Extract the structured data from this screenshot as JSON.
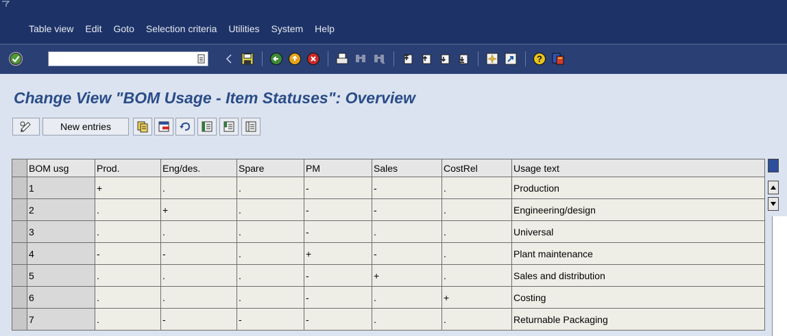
{
  "menu": {
    "items": [
      {
        "label": "Table view"
      },
      {
        "label": "Edit"
      },
      {
        "label": "Goto"
      },
      {
        "label": "Selection criteria"
      },
      {
        "label": "Utilities"
      },
      {
        "label": "System"
      },
      {
        "label": "Help"
      }
    ]
  },
  "toolbar": {
    "command_field_value": "",
    "icons": [
      "enter-icon",
      "back-arrow-icon",
      "save-icon",
      "back-icon",
      "exit-icon",
      "cancel-icon",
      "print-icon",
      "find-icon",
      "find-next-icon",
      "first-page-icon",
      "previous-page-icon",
      "next-page-icon",
      "last-page-icon",
      "create-session-icon",
      "shortcut-icon",
      "help-icon",
      "customize-layout-icon"
    ]
  },
  "title": "Change View \"BOM Usage - Item Statuses\": Overview",
  "app_toolbar": {
    "new_entries_label": "New entries"
  },
  "table": {
    "columns": [
      "BOM usg",
      "Prod.",
      "Eng/des.",
      "Spare",
      "PM",
      "Sales",
      "CostRel",
      "Usage text"
    ],
    "rows": [
      [
        "1",
        "+",
        ".",
        ".",
        "-",
        "-",
        ".",
        "Production"
      ],
      [
        "2",
        ".",
        "+",
        ".",
        "-",
        "-",
        ".",
        "Engineering/design"
      ],
      [
        "3",
        ".",
        ".",
        ".",
        "-",
        ".",
        ".",
        "Universal"
      ],
      [
        "4",
        "-",
        "-",
        ".",
        "+",
        "-",
        ".",
        "Plant maintenance"
      ],
      [
        "5",
        ".",
        ".",
        ".",
        "-",
        "+",
        ".",
        "Sales and distribution"
      ],
      [
        "6",
        ".",
        ".",
        ".",
        "-",
        ".",
        "+",
        "Costing"
      ],
      [
        "7",
        ".",
        "-",
        "-",
        "-",
        ".",
        ".",
        "Returnable Packaging"
      ]
    ]
  },
  "colors": {
    "menubar": "#1d3367",
    "title": "#2a4c88",
    "background": "#dbe3f0"
  }
}
